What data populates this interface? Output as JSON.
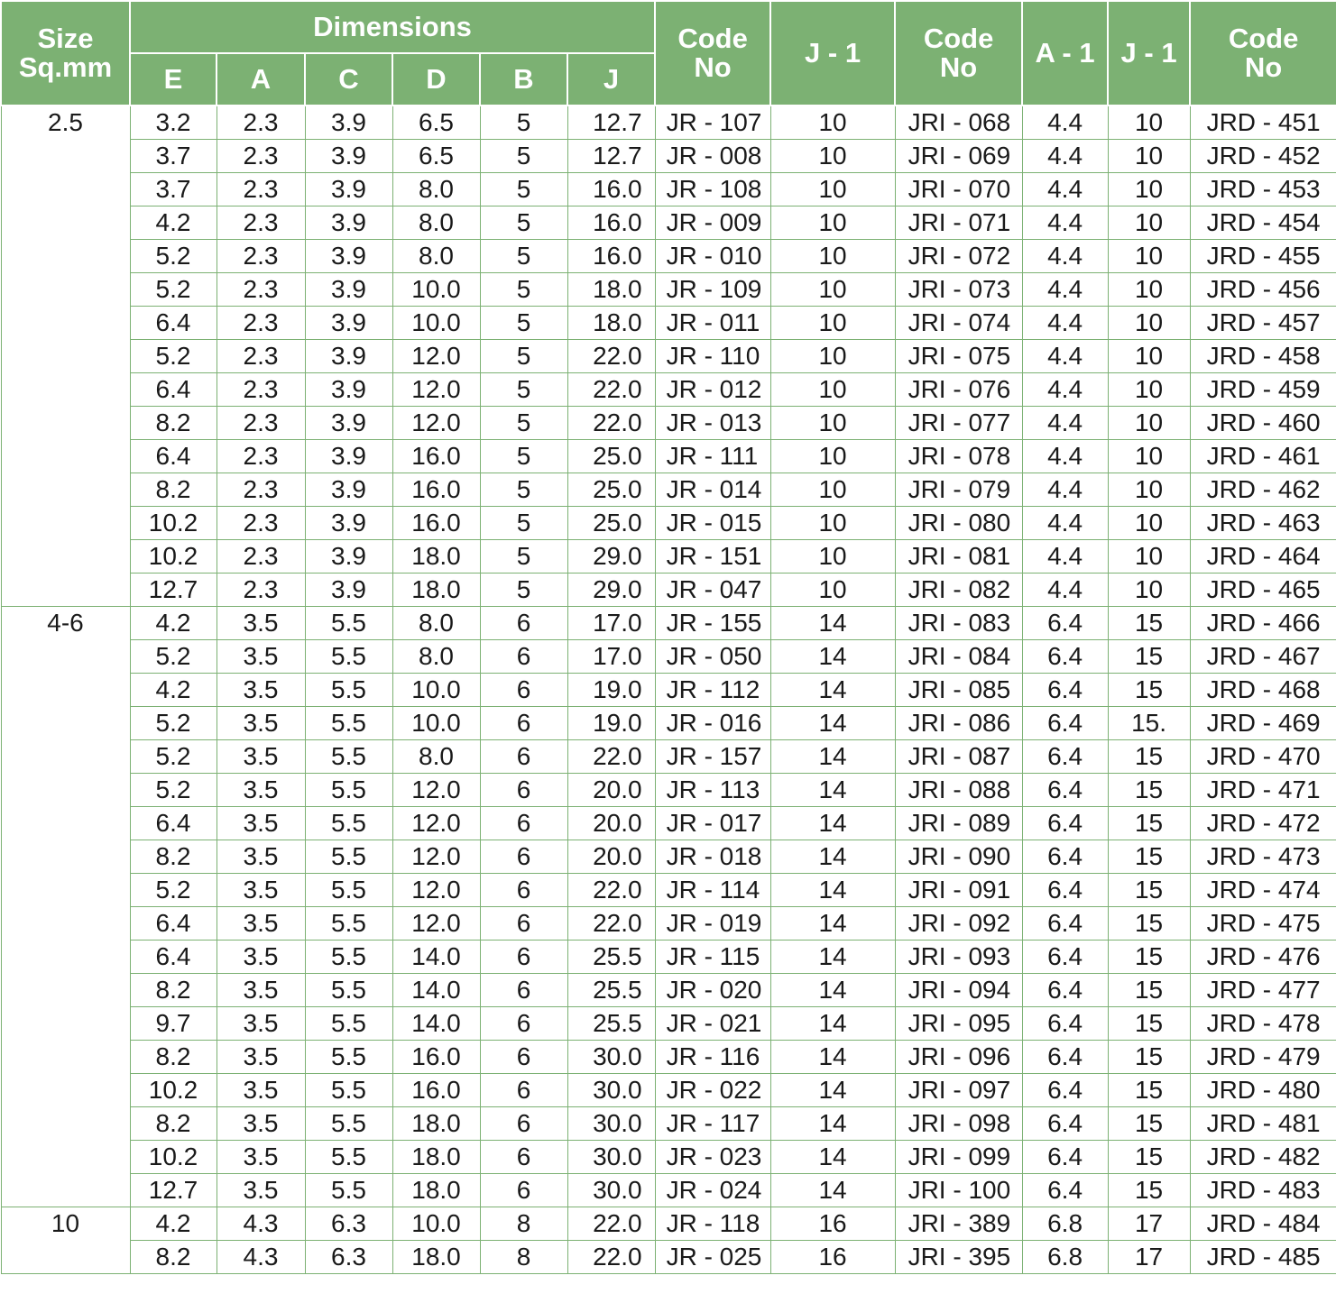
{
  "header": {
    "size": [
      "Size",
      "Sq.mm"
    ],
    "dimensions": "Dimensions",
    "dims": [
      "E",
      "A",
      "C",
      "D",
      "B",
      "J"
    ],
    "code_no_1": [
      "Code",
      "No"
    ],
    "j1_a": "J - 1",
    "code_no_2": [
      "Code",
      "No"
    ],
    "a1": "A - 1",
    "j1_b": "J - 1",
    "code_no_3": [
      "Code",
      "No"
    ]
  },
  "rows": [
    [
      "2.5",
      "3.2",
      "2.3",
      "3.9",
      "6.5",
      "5",
      "12.7",
      "JR - 107",
      "10",
      "JRI - 068",
      "4.4",
      "10",
      "JRD - 451"
    ],
    [
      "",
      "3.7",
      "2.3",
      "3.9",
      "6.5",
      "5",
      "12.7",
      "JR - 008",
      "10",
      "JRI - 069",
      "4.4",
      "10",
      "JRD - 452"
    ],
    [
      "",
      "3.7",
      "2.3",
      "3.9",
      "8.0",
      "5",
      "16.0",
      "JR - 108",
      "10",
      "JRI - 070",
      "4.4",
      "10",
      "JRD - 453"
    ],
    [
      "",
      "4.2",
      "2.3",
      "3.9",
      "8.0",
      "5",
      "16.0",
      "JR - 009",
      "10",
      "JRI - 071",
      "4.4",
      "10",
      "JRD - 454"
    ],
    [
      "",
      "5.2",
      "2.3",
      "3.9",
      "8.0",
      "5",
      "16.0",
      "JR - 010",
      "10",
      "JRI - 072",
      "4.4",
      "10",
      "JRD - 455"
    ],
    [
      "",
      "5.2",
      "2.3",
      "3.9",
      "10.0",
      "5",
      "18.0",
      "JR - 109",
      "10",
      "JRI - 073",
      "4.4",
      "10",
      "JRD - 456"
    ],
    [
      "",
      "6.4",
      "2.3",
      "3.9",
      "10.0",
      "5",
      "18.0",
      "JR - 011",
      "10",
      "JRI - 074",
      "4.4",
      "10",
      "JRD - 457"
    ],
    [
      "",
      "5.2",
      "2.3",
      "3.9",
      "12.0",
      "5",
      "22.0",
      "JR - 110",
      "10",
      "JRI - 075",
      "4.4",
      "10",
      "JRD - 458"
    ],
    [
      "",
      "6.4",
      "2.3",
      "3.9",
      "12.0",
      "5",
      "22.0",
      "JR - 012",
      "10",
      "JRI - 076",
      "4.4",
      "10",
      "JRD - 459"
    ],
    [
      "",
      "8.2",
      "2.3",
      "3.9",
      "12.0",
      "5",
      "22.0",
      "JR - 013",
      "10",
      "JRI - 077",
      "4.4",
      "10",
      "JRD - 460"
    ],
    [
      "",
      "6.4",
      "2.3",
      "3.9",
      "16.0",
      "5",
      "25.0",
      "JR - 111",
      "10",
      "JRI - 078",
      "4.4",
      "10",
      "JRD - 461"
    ],
    [
      "",
      "8.2",
      "2.3",
      "3.9",
      "16.0",
      "5",
      "25.0",
      "JR - 014",
      "10",
      "JRI - 079",
      "4.4",
      "10",
      "JRD - 462"
    ],
    [
      "",
      "10.2",
      "2.3",
      "3.9",
      "16.0",
      "5",
      "25.0",
      "JR - 015",
      "10",
      "JRI - 080",
      "4.4",
      "10",
      "JRD - 463"
    ],
    [
      "",
      "10.2",
      "2.3",
      "3.9",
      "18.0",
      "5",
      "29.0",
      "JR - 151",
      "10",
      "JRI - 081",
      "4.4",
      "10",
      "JRD - 464"
    ],
    [
      "",
      "12.7",
      "2.3",
      "3.9",
      "18.0",
      "5",
      "29.0",
      "JR - 047",
      "10",
      "JRI - 082",
      "4.4",
      "10",
      "JRD - 465"
    ],
    [
      "4-6",
      "4.2",
      "3.5",
      "5.5",
      "8.0",
      "6",
      "17.0",
      "JR - 155",
      "14",
      "JRI - 083",
      "6.4",
      "15",
      "JRD - 466"
    ],
    [
      "",
      "5.2",
      "3.5",
      "5.5",
      "8.0",
      "6",
      "17.0",
      "JR - 050",
      "14",
      "JRI - 084",
      "6.4",
      "15",
      "JRD - 467"
    ],
    [
      "",
      "4.2",
      "3.5",
      "5.5",
      "10.0",
      "6",
      "19.0",
      "JR - 112",
      "14",
      "JRI - 085",
      "6.4",
      "15",
      "JRD - 468"
    ],
    [
      "",
      "5.2",
      "3.5",
      "5.5",
      "10.0",
      "6",
      "19.0",
      "JR - 016",
      "14",
      "JRI - 086",
      "6.4",
      "15.",
      "JRD - 469"
    ],
    [
      "",
      "5.2",
      "3.5",
      "5.5",
      "8.0",
      "6",
      "22.0",
      "JR - 157",
      "14",
      "JRI - 087",
      "6.4",
      "15",
      "JRD - 470"
    ],
    [
      "",
      "5.2",
      "3.5",
      "5.5",
      "12.0",
      "6",
      "20.0",
      "JR - 113",
      "14",
      "JRI - 088",
      "6.4",
      "15",
      "JRD - 471"
    ],
    [
      "",
      "6.4",
      "3.5",
      "5.5",
      "12.0",
      "6",
      "20.0",
      "JR - 017",
      "14",
      "JRI - 089",
      "6.4",
      "15",
      "JRD - 472"
    ],
    [
      "",
      "8.2",
      "3.5",
      "5.5",
      "12.0",
      "6",
      "20.0",
      "JR - 018",
      "14",
      "JRI - 090",
      "6.4",
      "15",
      "JRD - 473"
    ],
    [
      "",
      "5.2",
      "3.5",
      "5.5",
      "12.0",
      "6",
      "22.0",
      "JR - 114",
      "14",
      "JRI - 091",
      "6.4",
      "15",
      "JRD - 474"
    ],
    [
      "",
      "6.4",
      "3.5",
      "5.5",
      "12.0",
      "6",
      "22.0",
      "JR - 019",
      "14",
      "JRI - 092",
      "6.4",
      "15",
      "JRD - 475"
    ],
    [
      "",
      "6.4",
      "3.5",
      "5.5",
      "14.0",
      "6",
      "25.5",
      "JR - 115",
      "14",
      "JRI - 093",
      "6.4",
      "15",
      "JRD - 476"
    ],
    [
      "",
      "8.2",
      "3.5",
      "5.5",
      "14.0",
      "6",
      "25.5",
      "JR - 020",
      "14",
      "JRI - 094",
      "6.4",
      "15",
      "JRD - 477"
    ],
    [
      "",
      "9.7",
      "3.5",
      "5.5",
      "14.0",
      "6",
      "25.5",
      "JR - 021",
      "14",
      "JRI - 095",
      "6.4",
      "15",
      "JRD - 478"
    ],
    [
      "",
      "8.2",
      "3.5",
      "5.5",
      "16.0",
      "6",
      "30.0",
      "JR - 116",
      "14",
      "JRI - 096",
      "6.4",
      "15",
      "JRD - 479"
    ],
    [
      "",
      "10.2",
      "3.5",
      "5.5",
      "16.0",
      "6",
      "30.0",
      "JR - 022",
      "14",
      "JRI - 097",
      "6.4",
      "15",
      "JRD - 480"
    ],
    [
      "",
      "8.2",
      "3.5",
      "5.5",
      "18.0",
      "6",
      "30.0",
      "JR - 117",
      "14",
      "JRI - 098",
      "6.4",
      "15",
      "JRD - 481"
    ],
    [
      "",
      "10.2",
      "3.5",
      "5.5",
      "18.0",
      "6",
      "30.0",
      "JR - 023",
      "14",
      "JRI - 099",
      "6.4",
      "15",
      "JRD - 482"
    ],
    [
      "",
      "12.7",
      "3.5",
      "5.5",
      "18.0",
      "6",
      "30.0",
      "JR - 024",
      "14",
      "JRI - 100",
      "6.4",
      "15",
      "JRD - 483"
    ],
    [
      "10",
      "4.2",
      "4.3",
      "6.3",
      "10.0",
      "8",
      "22.0",
      "JR - 118",
      "16",
      "JRI - 389",
      "6.8",
      "17",
      "JRD - 484"
    ],
    [
      "",
      "8.2",
      "4.3",
      "6.3",
      "18.0",
      "8",
      "22.0",
      "JR - 025",
      "16",
      "JRI - 395",
      "6.8",
      "17",
      "JRD - 485"
    ]
  ]
}
